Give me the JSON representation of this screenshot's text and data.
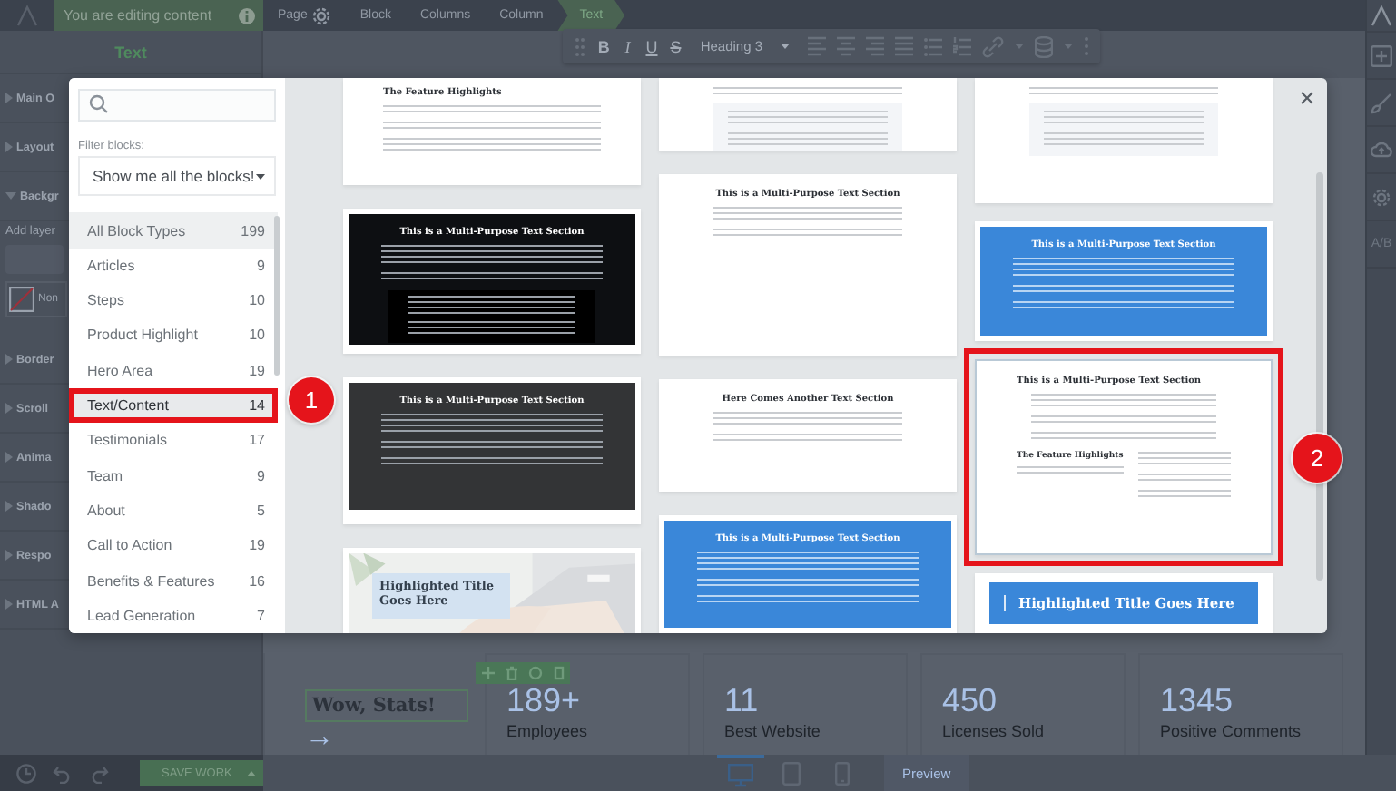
{
  "topbar": {
    "notice": "You are editing content",
    "breadcrumb": [
      {
        "label": "Page",
        "kind": "page",
        "selected": false
      },
      {
        "label": "Block",
        "kind": "crumb",
        "selected": false
      },
      {
        "label": "Columns",
        "kind": "crumb",
        "selected": false
      },
      {
        "label": "Column",
        "kind": "crumb",
        "selected": false
      },
      {
        "label": "Text",
        "kind": "crumb",
        "selected": true
      }
    ]
  },
  "toolbar": {
    "format": [
      "B",
      "I",
      "U",
      "S"
    ],
    "style": "Heading 3"
  },
  "right_sidebar": {
    "split_label": "A/B"
  },
  "panel": {
    "title": "Text",
    "sections": [
      {
        "label": "Main O",
        "expanded": false
      },
      {
        "label": "Layout",
        "expanded": false
      },
      {
        "label": "Backgr",
        "expanded": true,
        "add_label": "Add layer",
        "none_label": "Non"
      },
      {
        "label": "Border",
        "expanded": false
      },
      {
        "label": "Scroll",
        "expanded": false
      },
      {
        "label": "Anima",
        "expanded": false
      },
      {
        "label": "Shado",
        "expanded": false
      },
      {
        "label": "Respo",
        "expanded": false
      },
      {
        "label": "HTML A",
        "expanded": false
      }
    ]
  },
  "canvas": {
    "heading": "Wow, Stats!",
    "arrow": "→",
    "stats": [
      {
        "value": "189+",
        "label": "Employees"
      },
      {
        "value": "11",
        "label": "Best Website"
      },
      {
        "value": "450",
        "label": "Licenses Sold"
      },
      {
        "value": "1345",
        "label": "Positive Comments"
      }
    ]
  },
  "bottombar": {
    "save": "SAVE WORK",
    "devices": [
      {
        "kind": "desktop",
        "selected": true
      },
      {
        "kind": "tablet",
        "selected": false
      },
      {
        "kind": "phone",
        "selected": false
      }
    ],
    "preview": "Preview"
  },
  "modal": {
    "filter_label": "Filter blocks:",
    "filter_value": "Show me all the blocks!",
    "close": "×",
    "categories": [
      {
        "label": "All Block Types",
        "count": "199",
        "hovered": true,
        "selected": false,
        "outlined": false
      },
      {
        "label": "Articles",
        "count": "9",
        "hovered": false,
        "selected": false,
        "outlined": false
      },
      {
        "label": "Steps",
        "count": "10",
        "hovered": false,
        "selected": false,
        "outlined": false
      },
      {
        "label": "Product Highlight",
        "count": "10",
        "hovered": false,
        "selected": false,
        "outlined": false
      },
      {
        "label": "Hero Area",
        "count": "19",
        "hovered": false,
        "selected": false,
        "outlined": false
      },
      {
        "label": "Text/Content",
        "count": "14",
        "hovered": false,
        "selected": true,
        "outlined": true
      },
      {
        "label": "Testimonials",
        "count": "17",
        "hovered": false,
        "selected": false,
        "outlined": false
      },
      {
        "label": "Team",
        "count": "9",
        "hovered": false,
        "selected": false,
        "outlined": false
      },
      {
        "label": "About",
        "count": "5",
        "hovered": false,
        "selected": false,
        "outlined": false
      },
      {
        "label": "Call to Action",
        "count": "19",
        "hovered": false,
        "selected": false,
        "outlined": false
      },
      {
        "label": "Benefits & Features",
        "count": "16",
        "hovered": false,
        "selected": false,
        "outlined": false
      },
      {
        "label": "Lead Generation",
        "count": "7",
        "hovered": false,
        "selected": false,
        "outlined": false
      }
    ],
    "columns": [
      [
        {
          "kind": "list",
          "title": "The Feature Highlights",
          "outlined": false
        },
        {
          "kind": "dark",
          "title": "This is a Multi-Purpose Text Section",
          "outlined": false
        },
        {
          "kind": "charcoal",
          "title": "This is a Multi-Purpose Text Section",
          "outlined": false
        },
        {
          "title": "Highlighted Title Goes Here",
          "outlined": false
        }
      ],
      [
        {
          "kind": "boxed",
          "outlined": false
        },
        {
          "kind": "plain",
          "title": "This is a Multi-Purpose Text Section",
          "outlined": false
        },
        {
          "kind": "plain",
          "title": "Here Comes Another Text Section",
          "outlined": false
        },
        {
          "kind": "blue",
          "title": "This is a Multi-Purpose Text Section",
          "outlined": false
        }
      ],
      [
        {
          "kind": "boxed",
          "outlined": false
        },
        {
          "kind": "blue",
          "title": "This is a Multi-Purpose Text Section",
          "outlined": false
        },
        {
          "kind": "featured",
          "title": "This is a Multi-Purpose Text Section",
          "subtitle": "The Feature Highlights",
          "outlined": true
        },
        {
          "kind": "banner",
          "title": "Highlighted Title Goes Here",
          "outlined": false
        }
      ]
    ]
  },
  "annotations": [
    {
      "label": "1"
    },
    {
      "label": "2"
    }
  ]
}
